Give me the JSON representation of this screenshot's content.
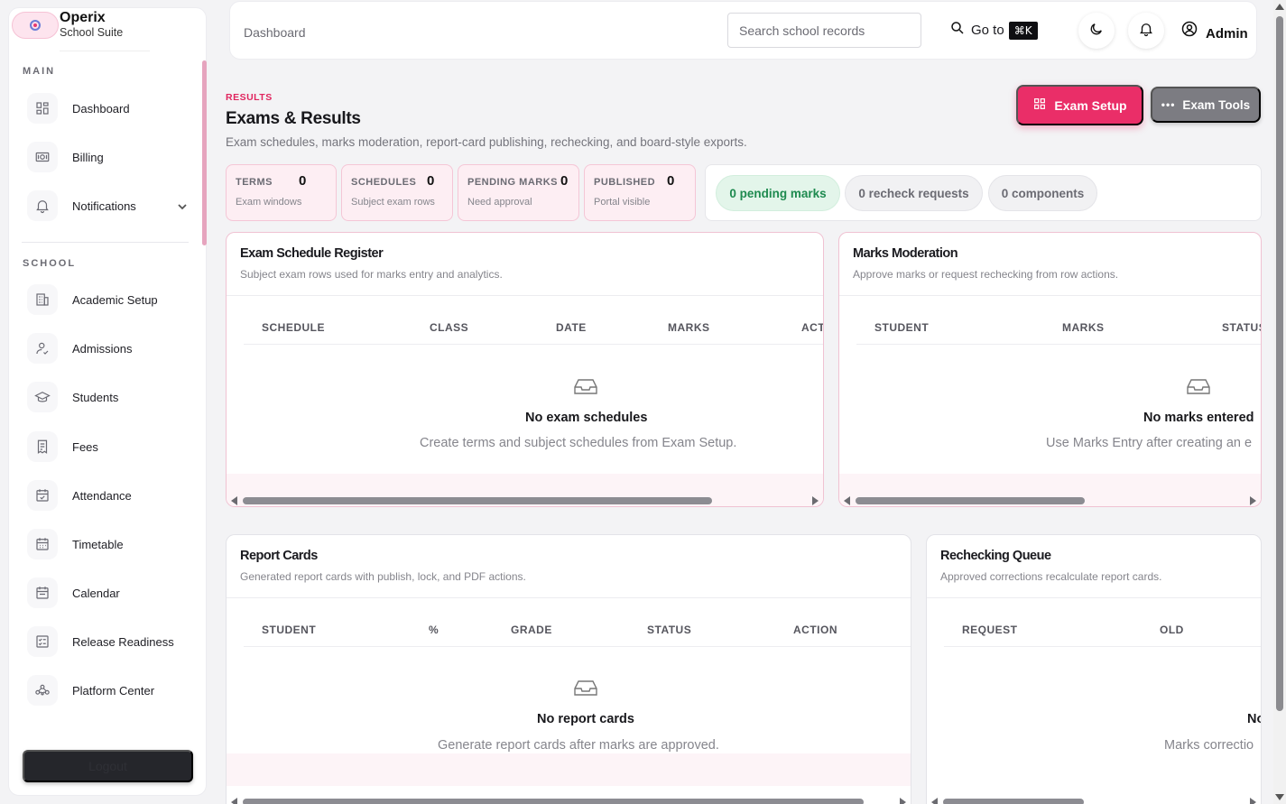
{
  "brand": {
    "name": "Operix",
    "subtitle": "School Suite"
  },
  "sidebar": {
    "main_label": "MAIN",
    "school_label": "SCHOOL",
    "main_items": [
      {
        "label": "Dashboard",
        "icon": "dashboard-icon"
      },
      {
        "label": "Billing",
        "icon": "billing-icon"
      },
      {
        "label": "Notifications",
        "icon": "bell-icon"
      }
    ],
    "school_items": [
      {
        "label": "Academic Setup",
        "icon": "building-icon"
      },
      {
        "label": "Admissions",
        "icon": "user-check-icon"
      },
      {
        "label": "Students",
        "icon": "graduation-cap-icon"
      },
      {
        "label": "Fees",
        "icon": "receipt-icon"
      },
      {
        "label": "Attendance",
        "icon": "calendar-check-icon"
      },
      {
        "label": "Timetable",
        "icon": "calendar-grid-icon"
      },
      {
        "label": "Calendar",
        "icon": "calendar-icon"
      },
      {
        "label": "Release Readiness",
        "icon": "checklist-icon"
      },
      {
        "label": "Platform Center",
        "icon": "network-icon"
      }
    ],
    "logout_label": "Logout"
  },
  "topbar": {
    "breadcrumb": "Dashboard",
    "search_placeholder": "Search school records",
    "goto_label": "Go to",
    "goto_shortcut": "⌘K",
    "user_label": "Admin"
  },
  "header": {
    "eyebrow": "RESULTS",
    "title": "Exams & Results",
    "description": "Exam schedules, marks moderation, report-card publishing, rechecking, and board-style exports.",
    "primary_button": "Exam Setup",
    "secondary_button": "Exam Tools"
  },
  "stats": [
    {
      "label": "TERMS",
      "value": "0",
      "sub": "Exam windows"
    },
    {
      "label": "SCHEDULES",
      "value": "0",
      "sub": "Subject exam rows"
    },
    {
      "label": "PENDING MARKS",
      "value": "0",
      "sub": "Need approval"
    },
    {
      "label": "PUBLISHED",
      "value": "0",
      "sub": "Portal visible"
    }
  ],
  "chips": [
    "0 pending marks",
    "0 recheck requests",
    "0 components"
  ],
  "panels": {
    "schedule": {
      "title": "Exam Schedule Register",
      "subtitle": "Subject exam rows used for marks entry and analytics.",
      "columns": [
        "SCHEDULE",
        "CLASS",
        "DATE",
        "MARKS",
        "ACT"
      ],
      "empty_title": "No exam schedules",
      "empty_sub": "Create terms and subject schedules from Exam Setup."
    },
    "moderation": {
      "title": "Marks Moderation",
      "subtitle": "Approve marks or request rechecking from row actions.",
      "columns": [
        "STUDENT",
        "MARKS",
        "STATUS"
      ],
      "empty_title": "No marks entered",
      "empty_sub": "Use Marks Entry after creating an e"
    },
    "report_cards": {
      "title": "Report Cards",
      "subtitle": "Generated report cards with publish, lock, and PDF actions.",
      "columns": [
        "STUDENT",
        "%",
        "GRADE",
        "STATUS",
        "ACTION"
      ],
      "empty_title": "No report cards",
      "empty_sub": "Generate report cards after marks are approved."
    },
    "rechecking": {
      "title": "Rechecking Queue",
      "subtitle": "Approved corrections recalculate report cards.",
      "columns": [
        "REQUEST",
        "OLD"
      ],
      "empty_title": "No",
      "empty_sub": "Marks correctio"
    }
  },
  "colors": {
    "accent": "#ea2e68",
    "success": "#1e8a4f",
    "secondary": "#7c7c82"
  }
}
